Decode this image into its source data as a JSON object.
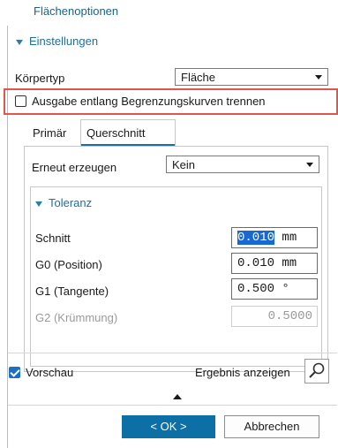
{
  "header": {
    "title": "Flächenoptionen"
  },
  "settings": {
    "section_label": "Einstellungen",
    "body_type_label": "Körpertyp",
    "body_type_value": "Fläche",
    "split_output_label": "Ausgabe entlang Begrenzungskurven trennen",
    "split_output_checked": false
  },
  "tabs": [
    {
      "label": "Primär",
      "active": false
    },
    {
      "label": "Querschnitt",
      "active": true
    }
  ],
  "regenerate": {
    "label": "Erneut erzeugen",
    "value": "Kein"
  },
  "tolerance": {
    "section_label": "Toleranz",
    "rows": [
      {
        "label": "Schnitt",
        "value_selected": "0.010",
        "unit": "mm",
        "enabled": true
      },
      {
        "label": "G0 (Position)",
        "value": "0.010 mm",
        "enabled": true
      },
      {
        "label": "G1 (Tangente)",
        "value": "0.500 °",
        "enabled": true
      },
      {
        "label": "G2 (Krümmung)",
        "value": "0.5000",
        "enabled": false
      }
    ]
  },
  "preview": {
    "label": "Vorschau",
    "checked": true,
    "show_result_label": "Ergebnis anzeigen"
  },
  "buttons": {
    "ok": "< OK >",
    "cancel": "Abbrechen"
  },
  "colors": {
    "accent": "#1f6f9a",
    "highlight": "#e3554a",
    "primary_button": "#0c6fa5",
    "selection": "#1967d2"
  }
}
